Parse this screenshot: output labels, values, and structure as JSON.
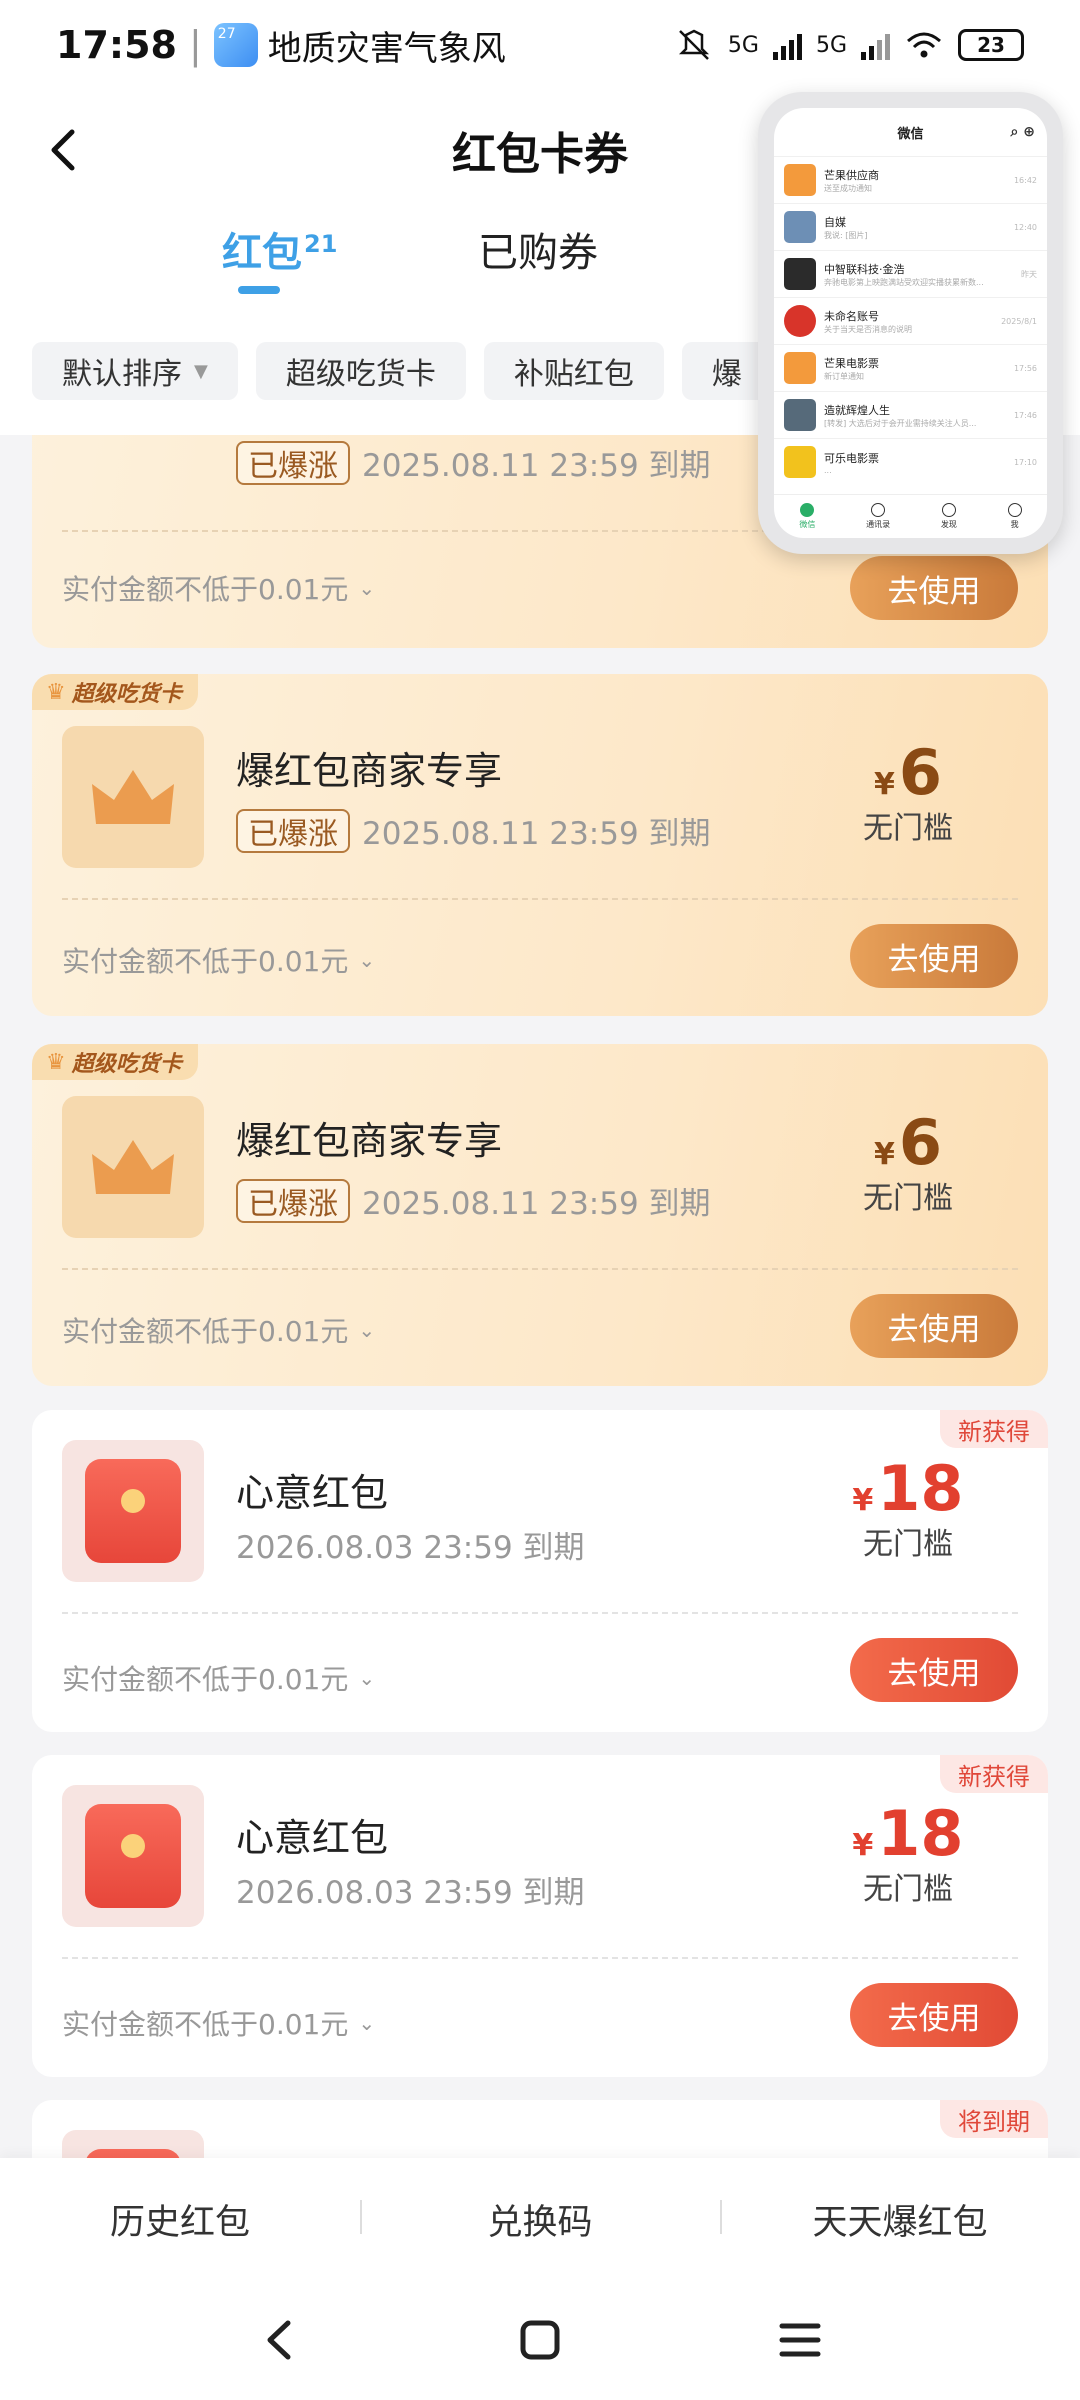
{
  "status": {
    "time": "17:58",
    "app": "地质灾害气象风",
    "weather_badge": "27",
    "net1": "5G",
    "net2": "5G",
    "battery": "23"
  },
  "header": {
    "title": "红包卡券",
    "tabs": [
      {
        "label": "红包",
        "count": "21"
      },
      {
        "label": "已购券"
      }
    ],
    "chips": [
      {
        "label": "默认排序"
      },
      {
        "label": "超级吃货卡"
      },
      {
        "label": "补贴红包"
      },
      {
        "label": "爆"
      }
    ]
  },
  "mini_window": {
    "title": "微信",
    "chats": [
      {
        "name": "芒果供应商",
        "msg": "送至成功通知",
        "time": "16:42"
      },
      {
        "name": "自媒",
        "msg": "我说: [图片]",
        "time": "12:40"
      },
      {
        "name": "中智联科技·金浩",
        "msg": "奔驰电影第上映跑满站受欢迎实播获累新数...",
        "time": "昨天"
      },
      {
        "name": "未命名账号",
        "msg": "关于当天是否消息的说明",
        "time": "2025/8/1"
      },
      {
        "name": "芒果电影票",
        "msg": "新订单通知",
        "time": "17:56"
      },
      {
        "name": "造就辉煌人生",
        "msg": "[转发] 大选后对于会开业需持续关注人员...",
        "time": "17:46"
      },
      {
        "name": "可乐电影票",
        "msg": "...",
        "time": "17:10"
      }
    ],
    "tabs": [
      "微信",
      "通讯录",
      "发现",
      "我"
    ]
  },
  "cards": [
    {
      "type": "gold",
      "tag": "已爆涨",
      "expiry": "2025.08.11 23:59 到期",
      "min_pay": "实付金额不低于0.01元",
      "button": "去使用"
    },
    {
      "type": "gold",
      "badge": "超级吃货卡",
      "title": "爆红包商家专享",
      "tag": "已爆涨",
      "expiry": "2025.08.11 23:59 到期",
      "currency": "¥",
      "amount": "6",
      "condition": "无门槛",
      "min_pay": "实付金额不低于0.01元",
      "button": "去使用"
    },
    {
      "type": "gold",
      "badge": "超级吃货卡",
      "title": "爆红包商家专享",
      "tag": "已爆涨",
      "expiry": "2025.08.11 23:59 到期",
      "currency": "¥",
      "amount": "6",
      "condition": "无门槛",
      "min_pay": "实付金额不低于0.01元",
      "button": "去使用"
    },
    {
      "type": "red",
      "badge": "新获得",
      "title": "心意红包",
      "expiry": "2026.08.03 23:59 到期",
      "currency": "¥",
      "amount": "18",
      "condition": "无门槛",
      "min_pay": "实付金额不低于0.01元",
      "button": "去使用"
    },
    {
      "type": "red",
      "badge": "新获得",
      "title": "心意红包",
      "expiry": "2026.08.03 23:59 到期",
      "currency": "¥",
      "amount": "18",
      "condition": "无门槛",
      "min_pay": "实付金额不低于0.01元",
      "button": "去使用"
    },
    {
      "type": "red",
      "badge": "将到期"
    }
  ],
  "bottom": {
    "items": [
      "历史红包",
      "兑换码",
      "天天爆红包"
    ]
  },
  "colors": {
    "accent_blue": "#3ea0e6",
    "gold_text": "#8a4a14",
    "red_amount": "#e2402f"
  }
}
